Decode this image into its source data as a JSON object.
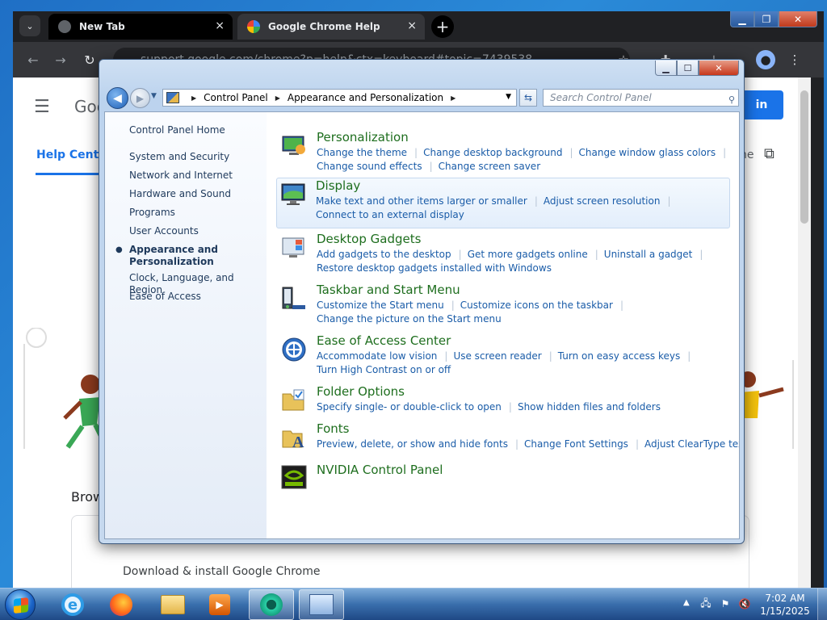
{
  "chrome": {
    "menu_glyph": "⌄",
    "tabs": [
      {
        "title": "New Tab",
        "close": "×"
      },
      {
        "title": "Google Chrome Help",
        "close": "×"
      }
    ],
    "new_tab": "+",
    "omnibox": "support.google.com/chrome?p=help&ctx=keyboard#topic=7439538",
    "page": {
      "logo_text": "Goo",
      "signin": "in",
      "help_center": "Help Center",
      "community": "ne",
      "browse_heading": "Brow",
      "download_text": "Download & install Google Chrome"
    }
  },
  "control_panel": {
    "address": {
      "crumbs": [
        "Control Panel",
        "Appearance and Personalization"
      ],
      "separator": "▶"
    },
    "search_placeholder": "Search Control Panel",
    "left_nav": [
      {
        "label": "Control Panel Home",
        "current": false
      },
      {
        "label": "System and Security",
        "current": false
      },
      {
        "label": "Network and Internet",
        "current": false
      },
      {
        "label": "Hardware and Sound",
        "current": false
      },
      {
        "label": "Programs",
        "current": false
      },
      {
        "label": "User Accounts",
        "current": false
      },
      {
        "label": "Appearance and Personalization",
        "current": true
      },
      {
        "label": "Clock, Language, and Region",
        "current": false
      },
      {
        "label": "Ease of Access",
        "current": false
      }
    ],
    "categories": [
      {
        "title": "Personalization",
        "icon": "personalization-icon",
        "lines": [
          [
            "Change the theme",
            "Change desktop background",
            "Change window glass colors"
          ],
          [
            "Change sound effects",
            "Change screen saver"
          ]
        ]
      },
      {
        "title": "Display",
        "icon": "display-icon",
        "lines": [
          [
            "Make text and other items larger or smaller",
            "Adjust screen resolution"
          ],
          [
            "Connect to an external display"
          ]
        ]
      },
      {
        "title": "Desktop Gadgets",
        "icon": "gadgets-icon",
        "lines": [
          [
            "Add gadgets to the desktop",
            "Get more gadgets online",
            "Uninstall a gadget"
          ],
          [
            "Restore desktop gadgets installed with Windows"
          ]
        ]
      },
      {
        "title": "Taskbar and Start Menu",
        "icon": "taskbar-icon",
        "lines": [
          [
            "Customize the Start menu",
            "Customize icons on the taskbar"
          ],
          [
            "Change the picture on the Start menu"
          ]
        ]
      },
      {
        "title": "Ease of Access Center",
        "icon": "ease-of-access-icon",
        "lines": [
          [
            "Accommodate low vision",
            "Use screen reader",
            "Turn on easy access keys"
          ],
          [
            "Turn High Contrast on or off"
          ]
        ]
      },
      {
        "title": "Folder Options",
        "icon": "folder-options-icon",
        "lines": [
          [
            "Specify single- or double-click to open",
            "Show hidden files and folders"
          ]
        ]
      },
      {
        "title": "Fonts",
        "icon": "fonts-icon",
        "lines": [
          [
            "Preview, delete, or show and hide fonts",
            "Change Font Settings",
            "Adjust ClearType text"
          ]
        ]
      },
      {
        "title": "NVIDIA Control Panel",
        "icon": "nvidia-icon",
        "lines": []
      }
    ]
  },
  "taskbar": {
    "clock_time": "7:02 AM",
    "clock_date": "1/15/2025"
  }
}
